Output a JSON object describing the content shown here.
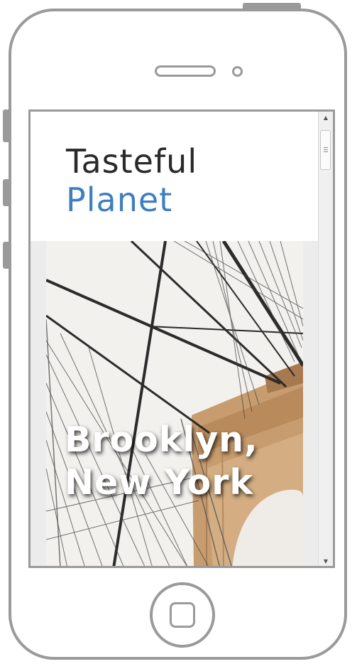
{
  "site": {
    "brand_line_1": "Tasteful",
    "brand_line_2": "Planet",
    "brand_colors": {
      "primary_text": "#2a2a2a",
      "accent": "#3f7fbf"
    }
  },
  "hero": {
    "title_line_1": "Brooklyn,",
    "title_line_2": "New York",
    "image_subject": "brooklyn-bridge-cables"
  },
  "scrollbar": {
    "up_arrow": "▲",
    "down_arrow": "▼"
  },
  "device": {
    "frame_color": "#9a9a9a",
    "type": "smartphone-outline"
  }
}
